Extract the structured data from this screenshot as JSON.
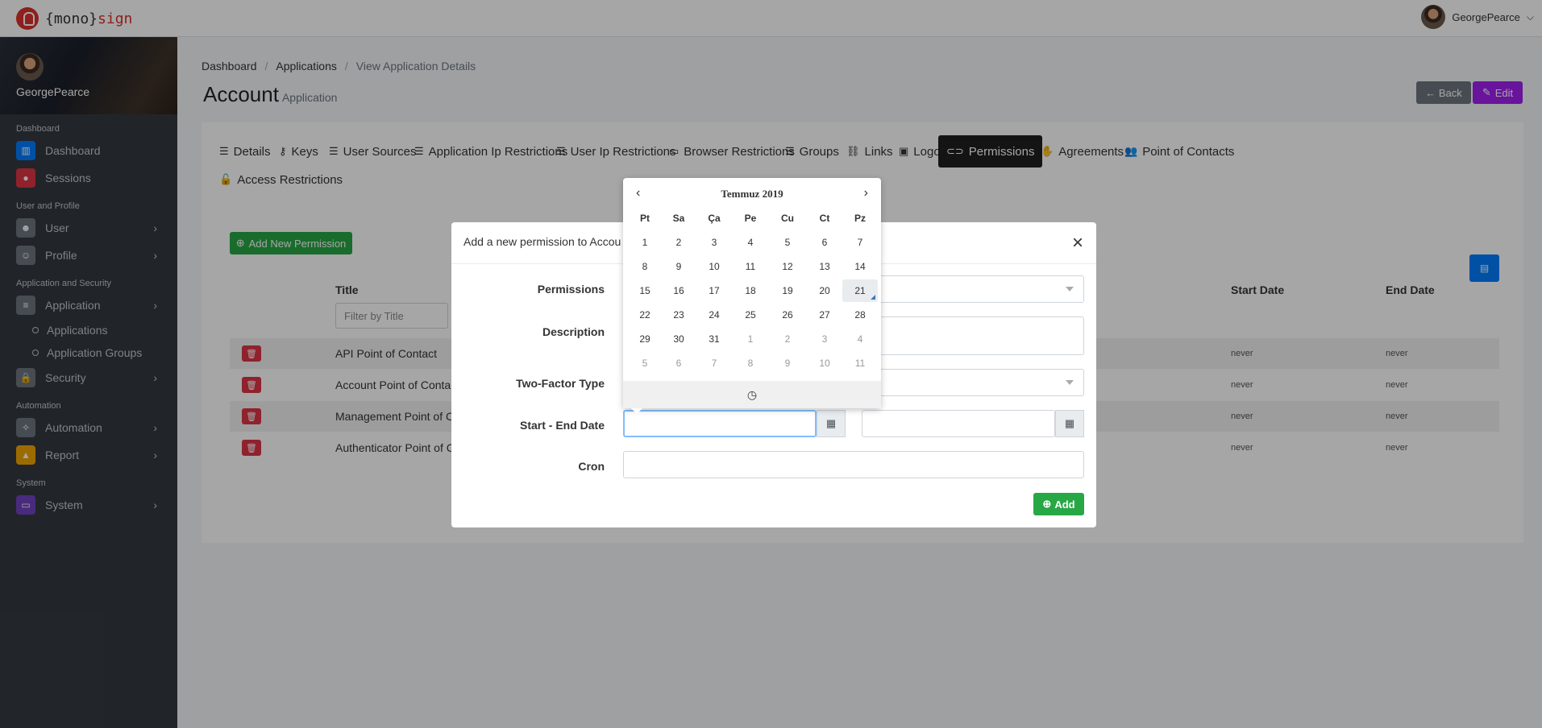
{
  "topbar": {
    "logo_open": "{mono}",
    "logo_close": "sign",
    "user": "GeorgePearce"
  },
  "sidebar": {
    "user": "GeorgePearce",
    "sections": [
      {
        "title": "Dashboard",
        "items": [
          {
            "label": "Dashboard",
            "icon": "chart-icon",
            "color": "#007bff"
          },
          {
            "label": "Sessions",
            "icon": "record-icon",
            "color": "#dc3545"
          }
        ]
      },
      {
        "title": "User and Profile",
        "items": [
          {
            "label": "User",
            "icon": "users-icon",
            "color": "#6c757d"
          },
          {
            "label": "Profile",
            "icon": "user-icon",
            "color": "#6c757d"
          }
        ]
      },
      {
        "title": "Application and Security",
        "items": [
          {
            "label": "Application",
            "icon": "server-icon",
            "color": "#6c757d"
          },
          {
            "label": "Security",
            "icon": "lock-icon",
            "color": "#6c757d"
          }
        ]
      },
      {
        "title": "Automation",
        "items": [
          {
            "label": "Automation",
            "icon": "magic-icon",
            "color": "#6c757d"
          },
          {
            "label": "Report",
            "icon": "area-chart-icon",
            "color": "#f0a500"
          }
        ]
      },
      {
        "title": "System",
        "items": [
          {
            "label": "System",
            "icon": "desktop-icon",
            "color": "#6f42c1"
          }
        ]
      }
    ],
    "subitems": [
      "Applications",
      "Application Groups"
    ]
  },
  "breadcrumb": [
    "Dashboard",
    "Applications",
    "View Application Details"
  ],
  "page": {
    "title": "Account",
    "subtitle": "Application",
    "back": "← Back",
    "edit": "Edit"
  },
  "tabs": [
    {
      "label": "Details",
      "icon": "☰"
    },
    {
      "label": "Keys",
      "icon": "⚷"
    },
    {
      "label": "User Sources",
      "icon": "☰"
    },
    {
      "label": "Application Ip Restrictions",
      "icon": "☰"
    },
    {
      "label": "User Ip Restrictions",
      "icon": "☰"
    },
    {
      "label": "Browser Restrictions",
      "icon": "▭"
    },
    {
      "label": "Groups",
      "icon": "☰"
    },
    {
      "label": "Links",
      "icon": "⛓"
    },
    {
      "label": "Logos",
      "icon": "▣"
    },
    {
      "label": "Permissions",
      "icon": "⊂⊃"
    },
    {
      "label": "Agreements",
      "icon": "✋"
    },
    {
      "label": "Point of Contacts",
      "icon": "👥"
    },
    {
      "label": "Access Restrictions",
      "icon": "🔓"
    }
  ],
  "table": {
    "add_button": "Add New Permission",
    "headers": {
      "title": "Title",
      "start": "Start Date",
      "end": "End Date"
    },
    "filter_placeholder": "Filter by Title",
    "rows": [
      {
        "title": "API Point of Contact",
        "start": "never",
        "end": "never"
      },
      {
        "title": "Account Point of Conta",
        "start": "never",
        "end": "never"
      },
      {
        "title": "Management Point of C",
        "start": "never",
        "end": "never"
      },
      {
        "title": "Authenticator Point of C",
        "start": "never",
        "end": "never"
      }
    ]
  },
  "modal": {
    "title": "Add a new permission to Accou",
    "labels": {
      "permissions": "Permissions",
      "description": "Description",
      "two_factor": "Two-Factor Type",
      "dates": "Start - End Date",
      "cron": "Cron"
    },
    "add": "Add"
  },
  "datepicker": {
    "title": "Temmuz 2019",
    "prev": "‹",
    "next": "›",
    "weekdays": [
      "Pt",
      "Sa",
      "Ça",
      "Pe",
      "Cu",
      "Ct",
      "Pz"
    ],
    "weeks": [
      [
        "1",
        "2",
        "3",
        "4",
        "5",
        "6",
        "7"
      ],
      [
        "8",
        "9",
        "10",
        "11",
        "12",
        "13",
        "14"
      ],
      [
        "15",
        "16",
        "17",
        "18",
        "19",
        "20",
        "21"
      ],
      [
        "22",
        "23",
        "24",
        "25",
        "26",
        "27",
        "28"
      ],
      [
        "29",
        "30",
        "31",
        "1",
        "2",
        "3",
        "4"
      ],
      [
        "5",
        "6",
        "7",
        "8",
        "9",
        "10",
        "11"
      ]
    ],
    "today": "21",
    "clock_icon": "clock-icon"
  }
}
